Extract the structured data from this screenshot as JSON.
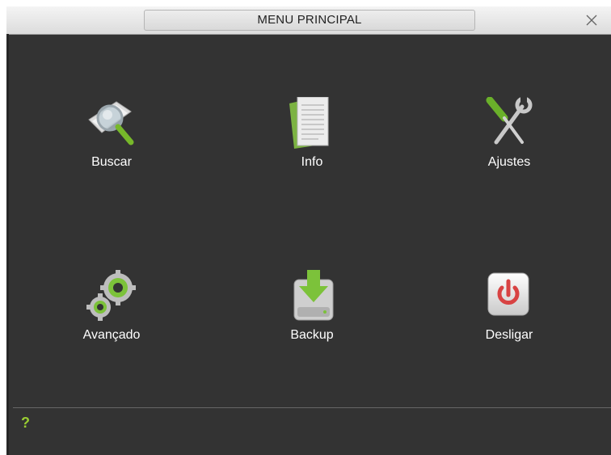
{
  "window": {
    "title": "MENU PRINCIPAL",
    "close_icon": "close-icon"
  },
  "menu": {
    "items": [
      {
        "label": "Buscar",
        "icon": "search-icon"
      },
      {
        "label": "Info",
        "icon": "info-document-icon"
      },
      {
        "label": "Ajustes",
        "icon": "wrench-screwdriver-icon"
      },
      {
        "label": "Avançado",
        "icon": "gears-icon"
      },
      {
        "label": "Backup",
        "icon": "backup-download-icon"
      },
      {
        "label": "Desligar",
        "icon": "power-icon"
      }
    ]
  },
  "footer": {
    "help_label": "?",
    "help_color": "#9acd32"
  },
  "colors": {
    "background": "#333333",
    "titlebar": "#e6e6e6",
    "text": "#ffffff"
  }
}
